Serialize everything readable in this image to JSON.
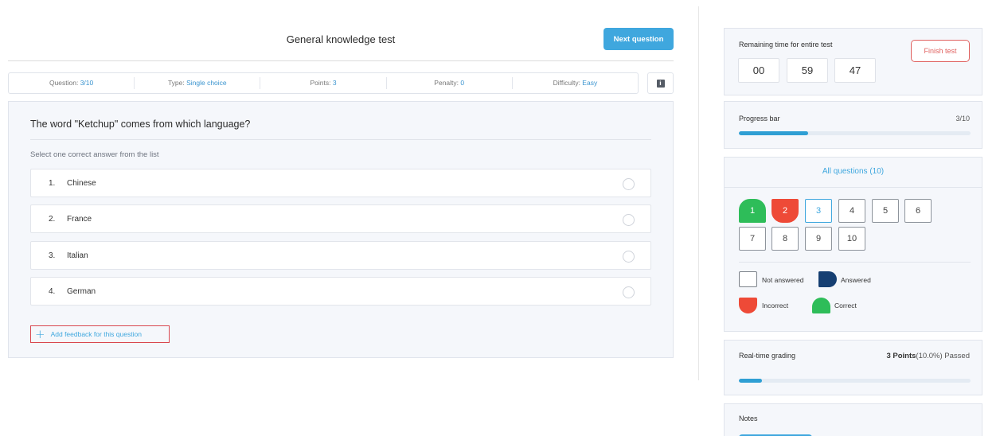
{
  "header": {
    "title": "General knowledge test",
    "next_label": "Next question"
  },
  "info": {
    "question_label": "Question: ",
    "question_value": "3/10",
    "type_label": "Type: ",
    "type_value": "Single choice",
    "points_label": "Points: ",
    "points_value": "3",
    "penalty_label": "Penalty: ",
    "penalty_value": "0",
    "difficulty_label": "Difficulty: ",
    "difficulty_value": "Easy",
    "info_icon": "info-icon"
  },
  "question": {
    "title": "The word \"Ketchup\" comes from which language?",
    "hint": "Select one correct answer from the list",
    "answers": [
      {
        "num": "1.",
        "text": "Chinese"
      },
      {
        "num": "2.",
        "text": "France"
      },
      {
        "num": "3.",
        "text": "Italian"
      },
      {
        "num": "4.",
        "text": "German"
      }
    ],
    "feedback_label": "Add feedback for this question",
    "feedback_icon": "plus-icon"
  },
  "timer": {
    "label": "Remaining time for entire test",
    "hours": "00",
    "minutes": "59",
    "seconds": "47",
    "finish_label": "Finish test"
  },
  "progress": {
    "label": "Progress bar",
    "count": "3/10",
    "fraction": 0.3
  },
  "questions_panel": {
    "title": "All questions (10)",
    "items": [
      {
        "label": "1",
        "state": "correct"
      },
      {
        "label": "2",
        "state": "incorrect"
      },
      {
        "label": "3",
        "state": "current"
      },
      {
        "label": "4",
        "state": "not-answered"
      },
      {
        "label": "5",
        "state": "not-answered"
      },
      {
        "label": "6",
        "state": "not-answered"
      },
      {
        "label": "7",
        "state": "not-answered"
      },
      {
        "label": "8",
        "state": "not-answered"
      },
      {
        "label": "9",
        "state": "not-answered"
      },
      {
        "label": "10",
        "state": "not-answered"
      }
    ],
    "legend": {
      "not_answered": "Not answered",
      "answered": "Answered",
      "incorrect": "Incorrect",
      "correct": "Correct"
    }
  },
  "grading": {
    "label": "Real-time grading",
    "points": "3 Points",
    "detail": "(10.0%) Passed",
    "fraction": 0.1
  },
  "notes": {
    "label": "Notes"
  },
  "colors": {
    "accent": "#3fa7de",
    "correct": "#2ebd59",
    "incorrect": "#ee4a37",
    "answered": "#163f72",
    "finish": "#e0615f"
  }
}
